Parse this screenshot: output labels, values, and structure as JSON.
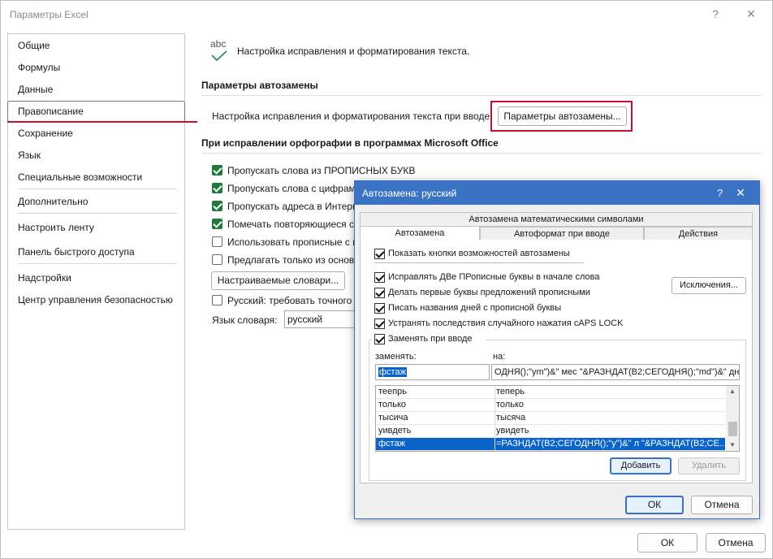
{
  "window": {
    "title": "Параметры Excel",
    "help_glyph": "?",
    "close_glyph": "✕"
  },
  "sidebar": {
    "items": [
      {
        "label": "Общие"
      },
      {
        "label": "Формулы"
      },
      {
        "label": "Данные"
      },
      {
        "label": "Правописание",
        "selected": true
      },
      {
        "label": "Сохранение"
      },
      {
        "label": "Язык"
      },
      {
        "label": "Специальные возможности"
      },
      {
        "label": "Дополнительно"
      },
      {
        "label": "Настроить ленту"
      },
      {
        "label": "Панель быстрого доступа"
      },
      {
        "label": "Надстройки"
      },
      {
        "label": "Центр управления безопасностью"
      }
    ]
  },
  "main": {
    "abc_text": "abc",
    "header_text": "Настройка исправления и форматирования текста.",
    "autocorrect_section_title": "Параметры автозамены",
    "autocorrect_prompt": "Настройка исправления и форматирования текста при вводе:",
    "autocorrect_button": "Параметры автозамены...",
    "spelling_section_title": "При исправлении орфографии в программах Microsoft Office",
    "options": [
      {
        "label": "Пропускать слова из ПРОПИСНЫХ БУКВ",
        "checked": true
      },
      {
        "label": "Пропускать слова с цифрам",
        "checked": true
      },
      {
        "label": "Пропускать адреса в Интерн",
        "checked": true
      },
      {
        "label": "Помечать повторяющиеся с",
        "checked": true
      },
      {
        "label": "Использовать прописные с к",
        "checked": false
      },
      {
        "label": "Предлагать только из основн",
        "checked": false
      }
    ],
    "custom_dict_button": "Настраиваемые словари...",
    "russian_option": "Русский: требовать точного",
    "dict_lang_label": "Язык словаря:",
    "dict_lang_value": "русский",
    "ok_button": "ОК",
    "cancel_button": "Отмена"
  },
  "dialog": {
    "title": "Автозамена: русский",
    "help_glyph": "?",
    "close_glyph": "✕",
    "tab_top": "Автозамена математическими символами",
    "tabs": [
      {
        "label": "Автозамена",
        "active": true
      },
      {
        "label": "Автоформат при вводе"
      },
      {
        "label": "Действия"
      }
    ],
    "show_buttons": {
      "label": "Показать кнопки возможностей автозамены",
      "checked": true
    },
    "options": [
      {
        "label": "Исправлять ДВе ПРописные буквы в начале слова",
        "checked": true
      },
      {
        "label": "Делать первые буквы предложений прописными",
        "checked": true
      },
      {
        "label": "Писать названия дней с прописной буквы",
        "checked": true
      },
      {
        "label": "Устранять последствия случайного нажатия cAPS LOCK",
        "checked": true
      }
    ],
    "exceptions_button": "Исключения...",
    "replace_group": {
      "label": "Заменять при вводе",
      "checked": true
    },
    "replace_label": "заменять:",
    "with_label": "на:",
    "replace_value": "фстаж",
    "with_value": "ОДНЯ();\"ym\")&\" мес \"&РАЗНДАТ(B2;СЕГОДНЯ();\"md\")&\" дн\"",
    "rows": [
      {
        "from": "теепрь",
        "to": "теперь"
      },
      {
        "from": "только",
        "to": "только"
      },
      {
        "from": "тысича",
        "to": "тысяча"
      },
      {
        "from": "уивдеть",
        "to": "увидеть"
      },
      {
        "from": "фстаж",
        "to": "=РАЗНДАТ(B2;СЕГОДНЯ();\"y\")&\" л \"&РАЗНДАТ(B2;СЕ...",
        "selected": true
      }
    ],
    "add_button": "Добавить",
    "delete_button": "Удалить",
    "ok_button": "ОК",
    "cancel_button": "Отмена"
  },
  "colors": {
    "highlight_red": "#c8102e",
    "dialog_title_blue": "#3a73c4",
    "selection_blue": "#0a63c9",
    "check_green": "#1f7a3c"
  }
}
